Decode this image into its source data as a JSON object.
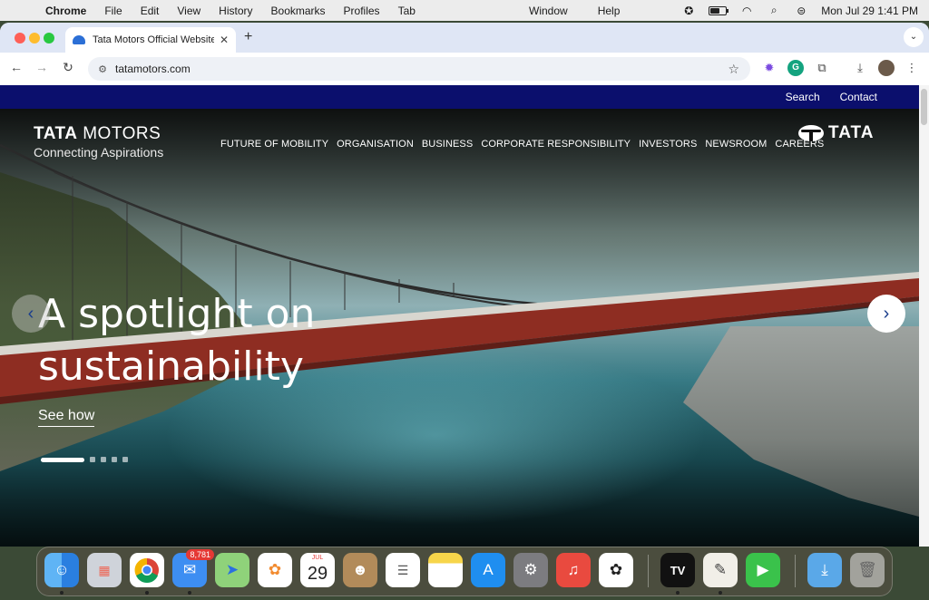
{
  "menubar": {
    "app_name": "Chrome",
    "items": [
      "File",
      "Edit",
      "View",
      "History",
      "Bookmarks",
      "Profiles",
      "Tab"
    ],
    "center_items": [
      "Window",
      "Help"
    ],
    "clock": "Mon Jul 29  1:41 PM"
  },
  "browser": {
    "tab_title": "Tata Motors Official Website |",
    "url": "tatamotors.com"
  },
  "site": {
    "utility": {
      "search": "Search",
      "contact": "Contact"
    },
    "brand": {
      "name_bold": "TATA",
      "name_light": " MOTORS",
      "tagline": "Connecting Aspirations"
    },
    "nav": [
      "FUTURE OF MOBILITY",
      "ORGANISATION",
      "BUSINESS",
      "CORPORATE RESPONSIBILITY",
      "INVESTORS",
      "NEWSROOM",
      "CAREERS"
    ],
    "group_logo": "TATA",
    "hero": {
      "headline_line1": "A spotlight on",
      "headline_line2": "sustainability",
      "cta": "See how",
      "slide_count": 5,
      "active_slide": 1
    }
  },
  "dock": {
    "mail_badge": "8,781",
    "calendar_month": "JUL",
    "calendar_day": "29",
    "apps": [
      "finder-icon",
      "launchpad-icon",
      "chrome-icon",
      "mail-icon",
      "maps-icon",
      "photos-icon",
      "calendar-icon",
      "contacts-icon",
      "reminders-icon",
      "notes-icon",
      "app-store-icon",
      "system-settings-icon",
      "music-icon",
      "chatgpt-icon",
      "tradingview-icon",
      "textedit-icon",
      "facetime-icon",
      "downloads-icon",
      "trash-icon"
    ]
  }
}
